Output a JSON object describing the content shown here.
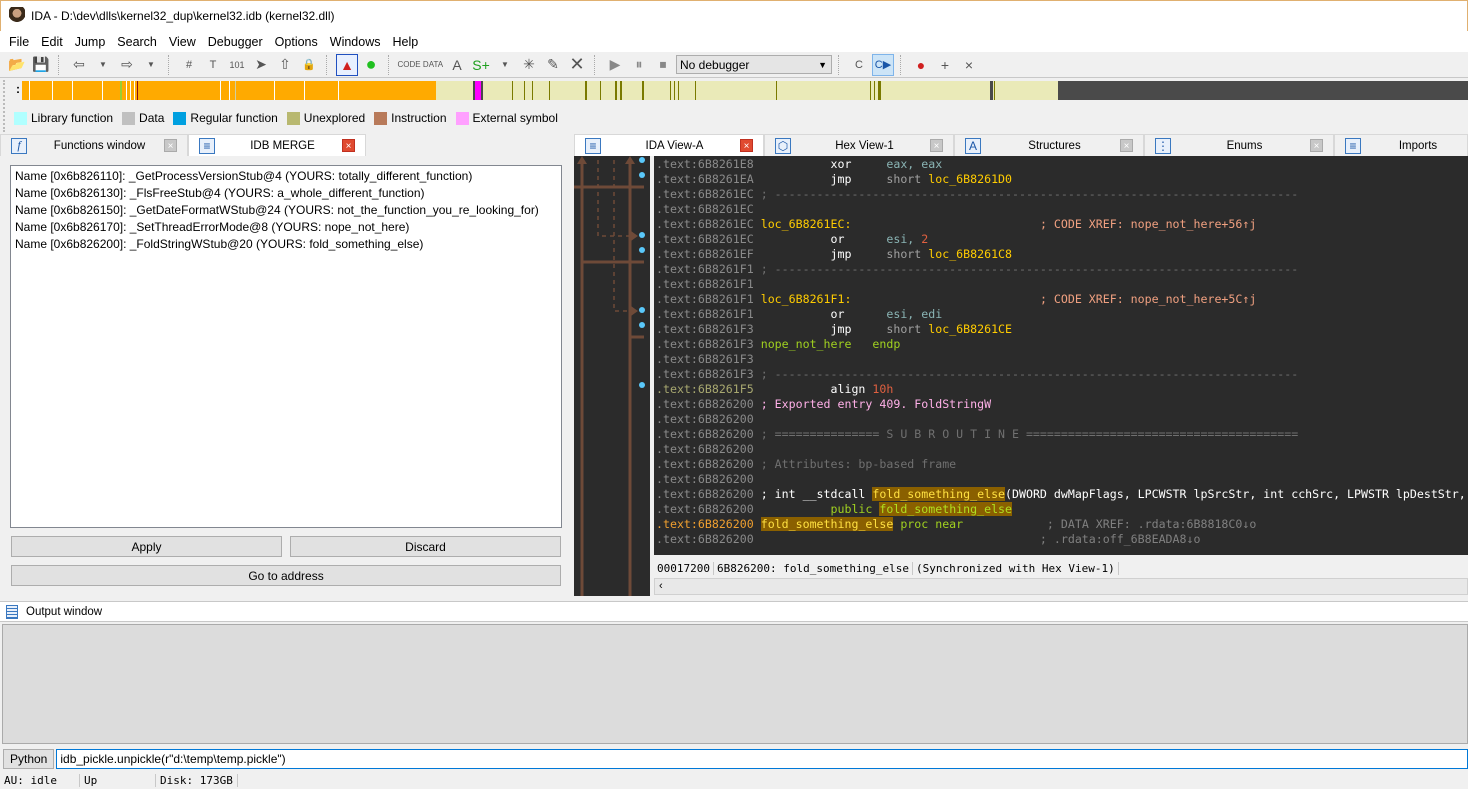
{
  "window": {
    "title": "IDA - D:\\dev\\dlls\\kernel32_dup\\kernel32.idb (kernel32.dll)"
  },
  "menu": [
    "File",
    "Edit",
    "Jump",
    "Search",
    "View",
    "Debugger",
    "Options",
    "Windows",
    "Help"
  ],
  "toolbar": {
    "icons": [
      "open-folder-icon",
      "save-icon",
      "back-icon",
      "back-dropdown-icon",
      "forward-icon",
      "forward-dropdown-icon",
      "search-hex-icon",
      "search-text-icon",
      "search-binary-icon",
      "search-next-icon",
      "jump-up-icon",
      "lock-icon",
      "warning-icon",
      "green-circle-icon",
      "make-code-icon",
      "make-data-icon",
      "make-ascii-icon",
      "make-struct-icon",
      "undefine-icon",
      "edit-icon",
      "delete-icon",
      "play-icon",
      "pause-icon",
      "stop-icon"
    ],
    "debugger_select": "No debugger",
    "right_icons": [
      "decompile-icon",
      "sync-code-icon",
      "breakpoint-list-icon",
      "add-breakpoint-icon",
      "remove-breakpoint-icon"
    ]
  },
  "navband": {
    "colors": {
      "library": "#b0ffff",
      "data": "#c0c0c0",
      "regular": "#00a0e0",
      "unexplored": "#b8b870",
      "instruction": "#b87a5a",
      "external": "#ffa0ff",
      "orange": "#ffaa00",
      "cream": "#eaeab8",
      "dark": "#4a4a4a",
      "olive": "#7a7a00",
      "magenta": "#ff00ff"
    }
  },
  "legend": [
    {
      "label": "Library function",
      "color": "#b0ffff"
    },
    {
      "label": "Data",
      "color": "#c0c0c0"
    },
    {
      "label": "Regular function",
      "color": "#00a0e0"
    },
    {
      "label": "Unexplored",
      "color": "#b8b870"
    },
    {
      "label": "Instruction",
      "color": "#b87a5a"
    },
    {
      "label": "External symbol",
      "color": "#ffa0ff"
    }
  ],
  "left_tabs": [
    {
      "label": "Functions window",
      "icon": "f"
    },
    {
      "label": "IDB MERGE",
      "icon": "list"
    }
  ],
  "merge": {
    "rows": [
      "Name [0x6b826110]: _GetProcessVersionStub@4 (YOURS: totally_different_function)",
      "Name [0x6b826130]: _FlsFreeStub@4 (YOURS: a_whole_different_function)",
      "Name [0x6b826150]: _GetDateFormatWStub@24 (YOURS: not_the_function_you_re_looking_for)",
      "Name [0x6b826170]: _SetThreadErrorMode@8 (YOURS: nope_not_here)",
      "Name [0x6b826200]: _FoldStringWStub@20 (YOURS: fold_something_else)"
    ],
    "apply": "Apply",
    "discard": "Discard",
    "goto": "Go to address"
  },
  "ida_tabs": [
    {
      "label": "IDA View-A"
    },
    {
      "label": "Hex View-1"
    },
    {
      "label": "Structures"
    },
    {
      "label": "Enums"
    },
    {
      "label": "Imports"
    }
  ],
  "disasm": {
    "lines": [
      {
        "addr": ".text:6B8261E8",
        "mn": "xor",
        "ops": [
          [
            "reg",
            "eax, eax"
          ]
        ]
      },
      {
        "addr": ".text:6B8261EA",
        "mn": "jmp",
        "ops": [
          [
            "plain",
            "short "
          ],
          [
            "lbl",
            "loc_6B8261D0"
          ]
        ]
      },
      {
        "addr": ".text:6B8261EC",
        "sep": " ; ---------------------------------------------------------------------------"
      },
      {
        "addr": ".text:6B8261EC"
      },
      {
        "addr": ".text:6B8261EC",
        "label": "loc_6B8261EC:",
        "comment": "; CODE XREF: nope_not_here+56↑j"
      },
      {
        "addr": ".text:6B8261EC",
        "mn": "or",
        "ops": [
          [
            "reg",
            "esi, "
          ],
          [
            "num",
            "2"
          ]
        ]
      },
      {
        "addr": ".text:6B8261EF",
        "mn": "jmp",
        "ops": [
          [
            "plain",
            "short "
          ],
          [
            "lbl",
            "loc_6B8261C8"
          ]
        ]
      },
      {
        "addr": ".text:6B8261F1",
        "sep": " ; ---------------------------------------------------------------------------"
      },
      {
        "addr": ".text:6B8261F1"
      },
      {
        "addr": ".text:6B8261F1",
        "label": "loc_6B8261F1:",
        "comment": "; CODE XREF: nope_not_here+5C↑j"
      },
      {
        "addr": ".text:6B8261F1",
        "mn": "or",
        "ops": [
          [
            "reg",
            "esi, edi"
          ]
        ]
      },
      {
        "addr": ".text:6B8261F3",
        "mn": "jmp",
        "ops": [
          [
            "plain",
            "short "
          ],
          [
            "lbl",
            "loc_6B8261CE"
          ]
        ]
      },
      {
        "addr": ".text:6B8261F3",
        "endp_name": "nope_not_here",
        "endp": "endp"
      },
      {
        "addr": ".text:6B8261F3"
      },
      {
        "addr": ".text:6B8261F3",
        "sep": " ; ---------------------------------------------------------------------------"
      },
      {
        "addr": ".text:6B8261F5",
        "olive": true,
        "mn": "align",
        "ops": [
          [
            "num",
            "10h"
          ]
        ]
      },
      {
        "addr": ".text:6B826200",
        "pink": " ; Exported entry 409. FoldStringW"
      },
      {
        "addr": ".text:6B826200"
      },
      {
        "addr": ".text:6B826200",
        "sep": " ; =============== S U B R O U T I N E ======================================="
      },
      {
        "addr": ".text:6B826200"
      },
      {
        "addr": ".text:6B826200",
        "sep": " ; Attributes: bp-based frame"
      },
      {
        "addr": ".text:6B826200"
      },
      {
        "addr": ".text:6B826200",
        "proto": true
      },
      {
        "addr": ".text:6B826200",
        "public": true
      },
      {
        "addr": ".text:6B826200",
        "cur": true,
        "procline": true
      },
      {
        "addr": ".text:6B826200",
        "cont_comment": "; .rdata:off_6B8EADA8↓o"
      }
    ],
    "proto_prefix": " ; int __stdcall ",
    "func_name": "fold_something_else",
    "proto_args": "(DWORD dwMapFlags, LPCWSTR lpSrcStr, int cchSrc, LPWSTR lpDestStr, int cchDest)",
    "public_kw": "public",
    "proc_kw": "proc near",
    "proc_comment": "; DATA XREF: .rdata:6B8818C0↓o"
  },
  "ida_status": {
    "offset": "00017200",
    "location": "6B826200: fold_something_else",
    "sync": "(Synchronized with Hex View-1)"
  },
  "output": {
    "title": "Output window",
    "cli_lang": "Python",
    "cli_value": "idb_pickle.unpickle(r\"d:\\temp\\temp.pickle\")"
  },
  "statusbar": {
    "au": "AU:  idle",
    "dir": "Up",
    "disk": "Disk: 173GB"
  }
}
